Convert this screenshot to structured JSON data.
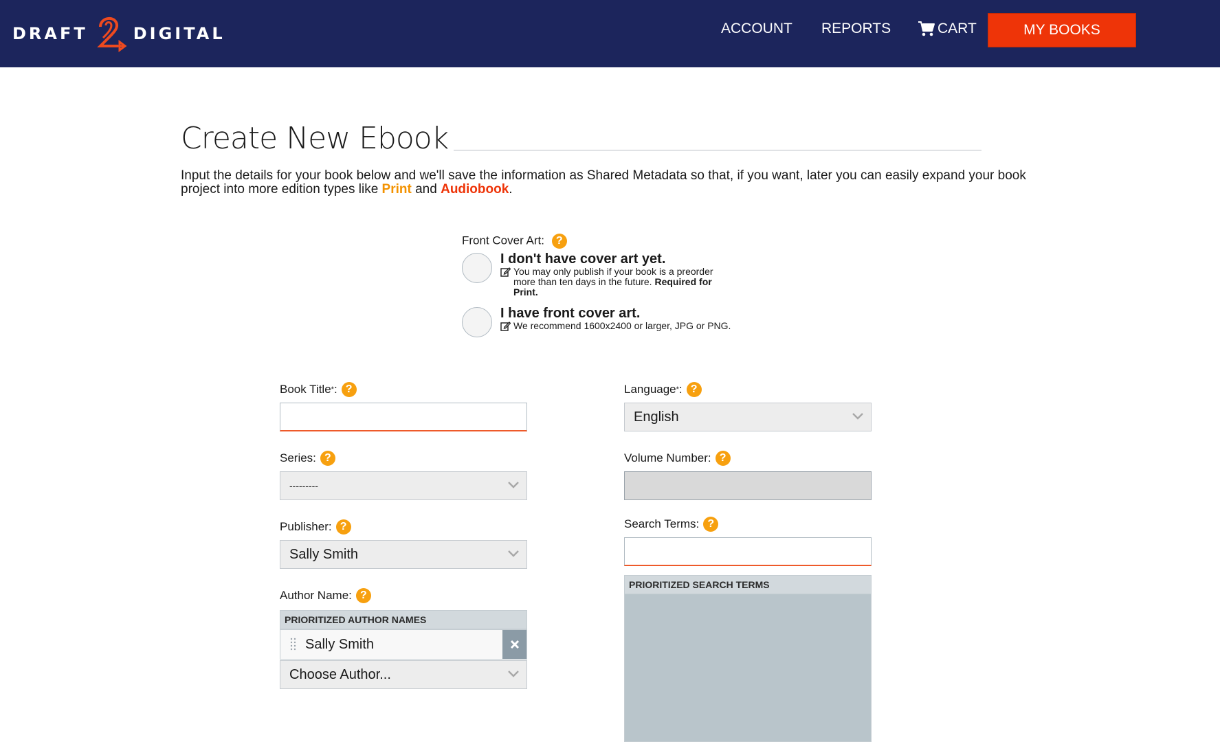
{
  "header": {
    "logo": {
      "left_word": "DRAFT",
      "mark": "2",
      "right_word": "DIGITAL"
    },
    "nav": {
      "account": "ACCOUNT",
      "reports": "REPORTS",
      "cart": "CART",
      "my_books": "MY BOOKS"
    },
    "icons": {
      "cart": "cart-icon"
    },
    "colors": {
      "bar": "#1c255c",
      "accent": "#ee3408"
    }
  },
  "page": {
    "title": "Create New Ebook",
    "intro_part1": "Input the details for your book below and we'll save the information as Shared Metadata so that, if you want, later you can easily expand your book project into more edition types like ",
    "intro_print": "Print",
    "intro_and": " and ",
    "intro_audiobook": "Audiobook",
    "intro_end": "."
  },
  "cover_art": {
    "label": "Front Cover Art:",
    "options": [
      {
        "title": "I don't have cover art yet.",
        "sub": "You may only publish if your book is a preorder more than ten days in the future. ",
        "sub_bold": "Required for Print.",
        "selected": false
      },
      {
        "title": "I have front cover art.",
        "sub": "We recommend 1600x2400 or larger, JPG or PNG.",
        "sub_bold": "",
        "selected": false
      }
    ]
  },
  "form": {
    "book_title": {
      "label": "Book Title",
      "required": "*",
      "suffix": ":",
      "value": ""
    },
    "series": {
      "label": "Series:",
      "value": "---------"
    },
    "publisher": {
      "label": "Publisher:",
      "value": "Sally Smith"
    },
    "author": {
      "label": "Author Name:",
      "list_header": "PRIORITIZED AUTHOR NAMES",
      "authors": [
        "Sally Smith"
      ],
      "choose_placeholder": "Choose Author..."
    },
    "language": {
      "label": "Language",
      "required": "*",
      "suffix": ":",
      "value": "English"
    },
    "volume_number": {
      "label": "Volume Number:",
      "value": ""
    },
    "search_terms": {
      "label": "Search Terms:",
      "value": "",
      "list_header": "PRIORITIZED SEARCH TERMS"
    }
  },
  "help_glyph": "?"
}
